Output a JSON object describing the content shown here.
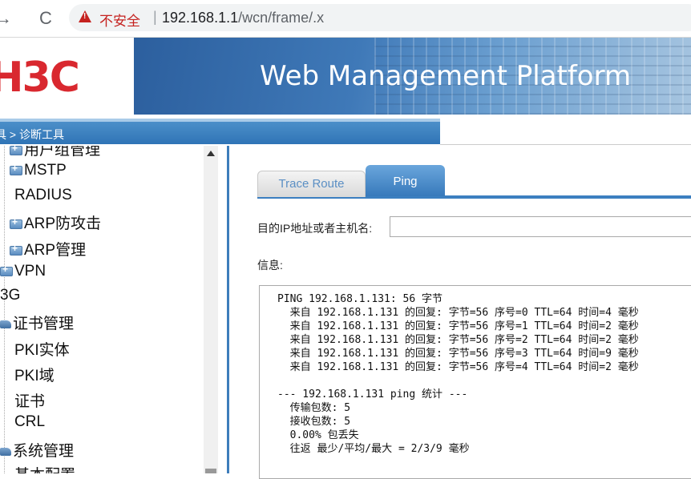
{
  "browser": {
    "back_icon": "→",
    "reload_icon": "C",
    "insecure_label": "不安全",
    "separator": "|",
    "url_host": "192.168.1.1",
    "url_path": "/wcn/frame/.x"
  },
  "header": {
    "logo_text": "H3C",
    "banner_title": "Web Management Platform"
  },
  "breadcrumb": {
    "text": "具 > 诊断工具"
  },
  "sidebar": {
    "items": [
      {
        "label": "用户组管理",
        "icon": "plus-icon"
      },
      {
        "label": "MSTP",
        "icon": "plus-icon"
      },
      {
        "label": "RADIUS",
        "icon": ""
      },
      {
        "label": "ARP防攻击",
        "icon": "plus-icon"
      },
      {
        "label": "ARP管理",
        "icon": "plus-icon"
      },
      {
        "label": "VPN",
        "icon": "plus-icon"
      },
      {
        "label": "3G",
        "icon": ""
      },
      {
        "label": "证书管理",
        "icon": "folder-icon"
      },
      {
        "label": "PKI实体",
        "icon": ""
      },
      {
        "label": "PKI域",
        "icon": ""
      },
      {
        "label": "证书",
        "icon": ""
      },
      {
        "label": "CRL",
        "icon": ""
      },
      {
        "label": "系统管理",
        "icon": "folder-icon"
      },
      {
        "label": "基本配置",
        "icon": ""
      }
    ]
  },
  "main": {
    "tabs": [
      {
        "label": "Trace Route"
      },
      {
        "label": "Ping"
      }
    ],
    "active_tab": "Ping",
    "target_label": "目的IP地址或者主机名:",
    "target_value": "",
    "info_label": "信息:",
    "output_lines": [
      "PING 192.168.1.131: 56 字节",
      "  来自 192.168.1.131 的回复: 字节=56 序号=0 TTL=64 时间=4 毫秒",
      "  来自 192.168.1.131 的回复: 字节=56 序号=1 TTL=64 时间=2 毫秒",
      "  来自 192.168.1.131 的回复: 字节=56 序号=2 TTL=64 时间=2 毫秒",
      "  来自 192.168.1.131 的回复: 字节=56 序号=3 TTL=64 时间=9 毫秒",
      "  来自 192.168.1.131 的回复: 字节=56 序号=4 TTL=64 时间=2 毫秒",
      "",
      "--- 192.168.1.131 ping 统计 ---",
      "  传输包数: 5",
      "  接收包数: 5",
      "  0.00% 包丢失",
      "  往返 最少/平均/最大 = 2/3/9 毫秒"
    ]
  },
  "colors": {
    "brand_red": "#d9282f",
    "accent_blue": "#3c7fc0",
    "insecure_red": "#c5221f"
  }
}
